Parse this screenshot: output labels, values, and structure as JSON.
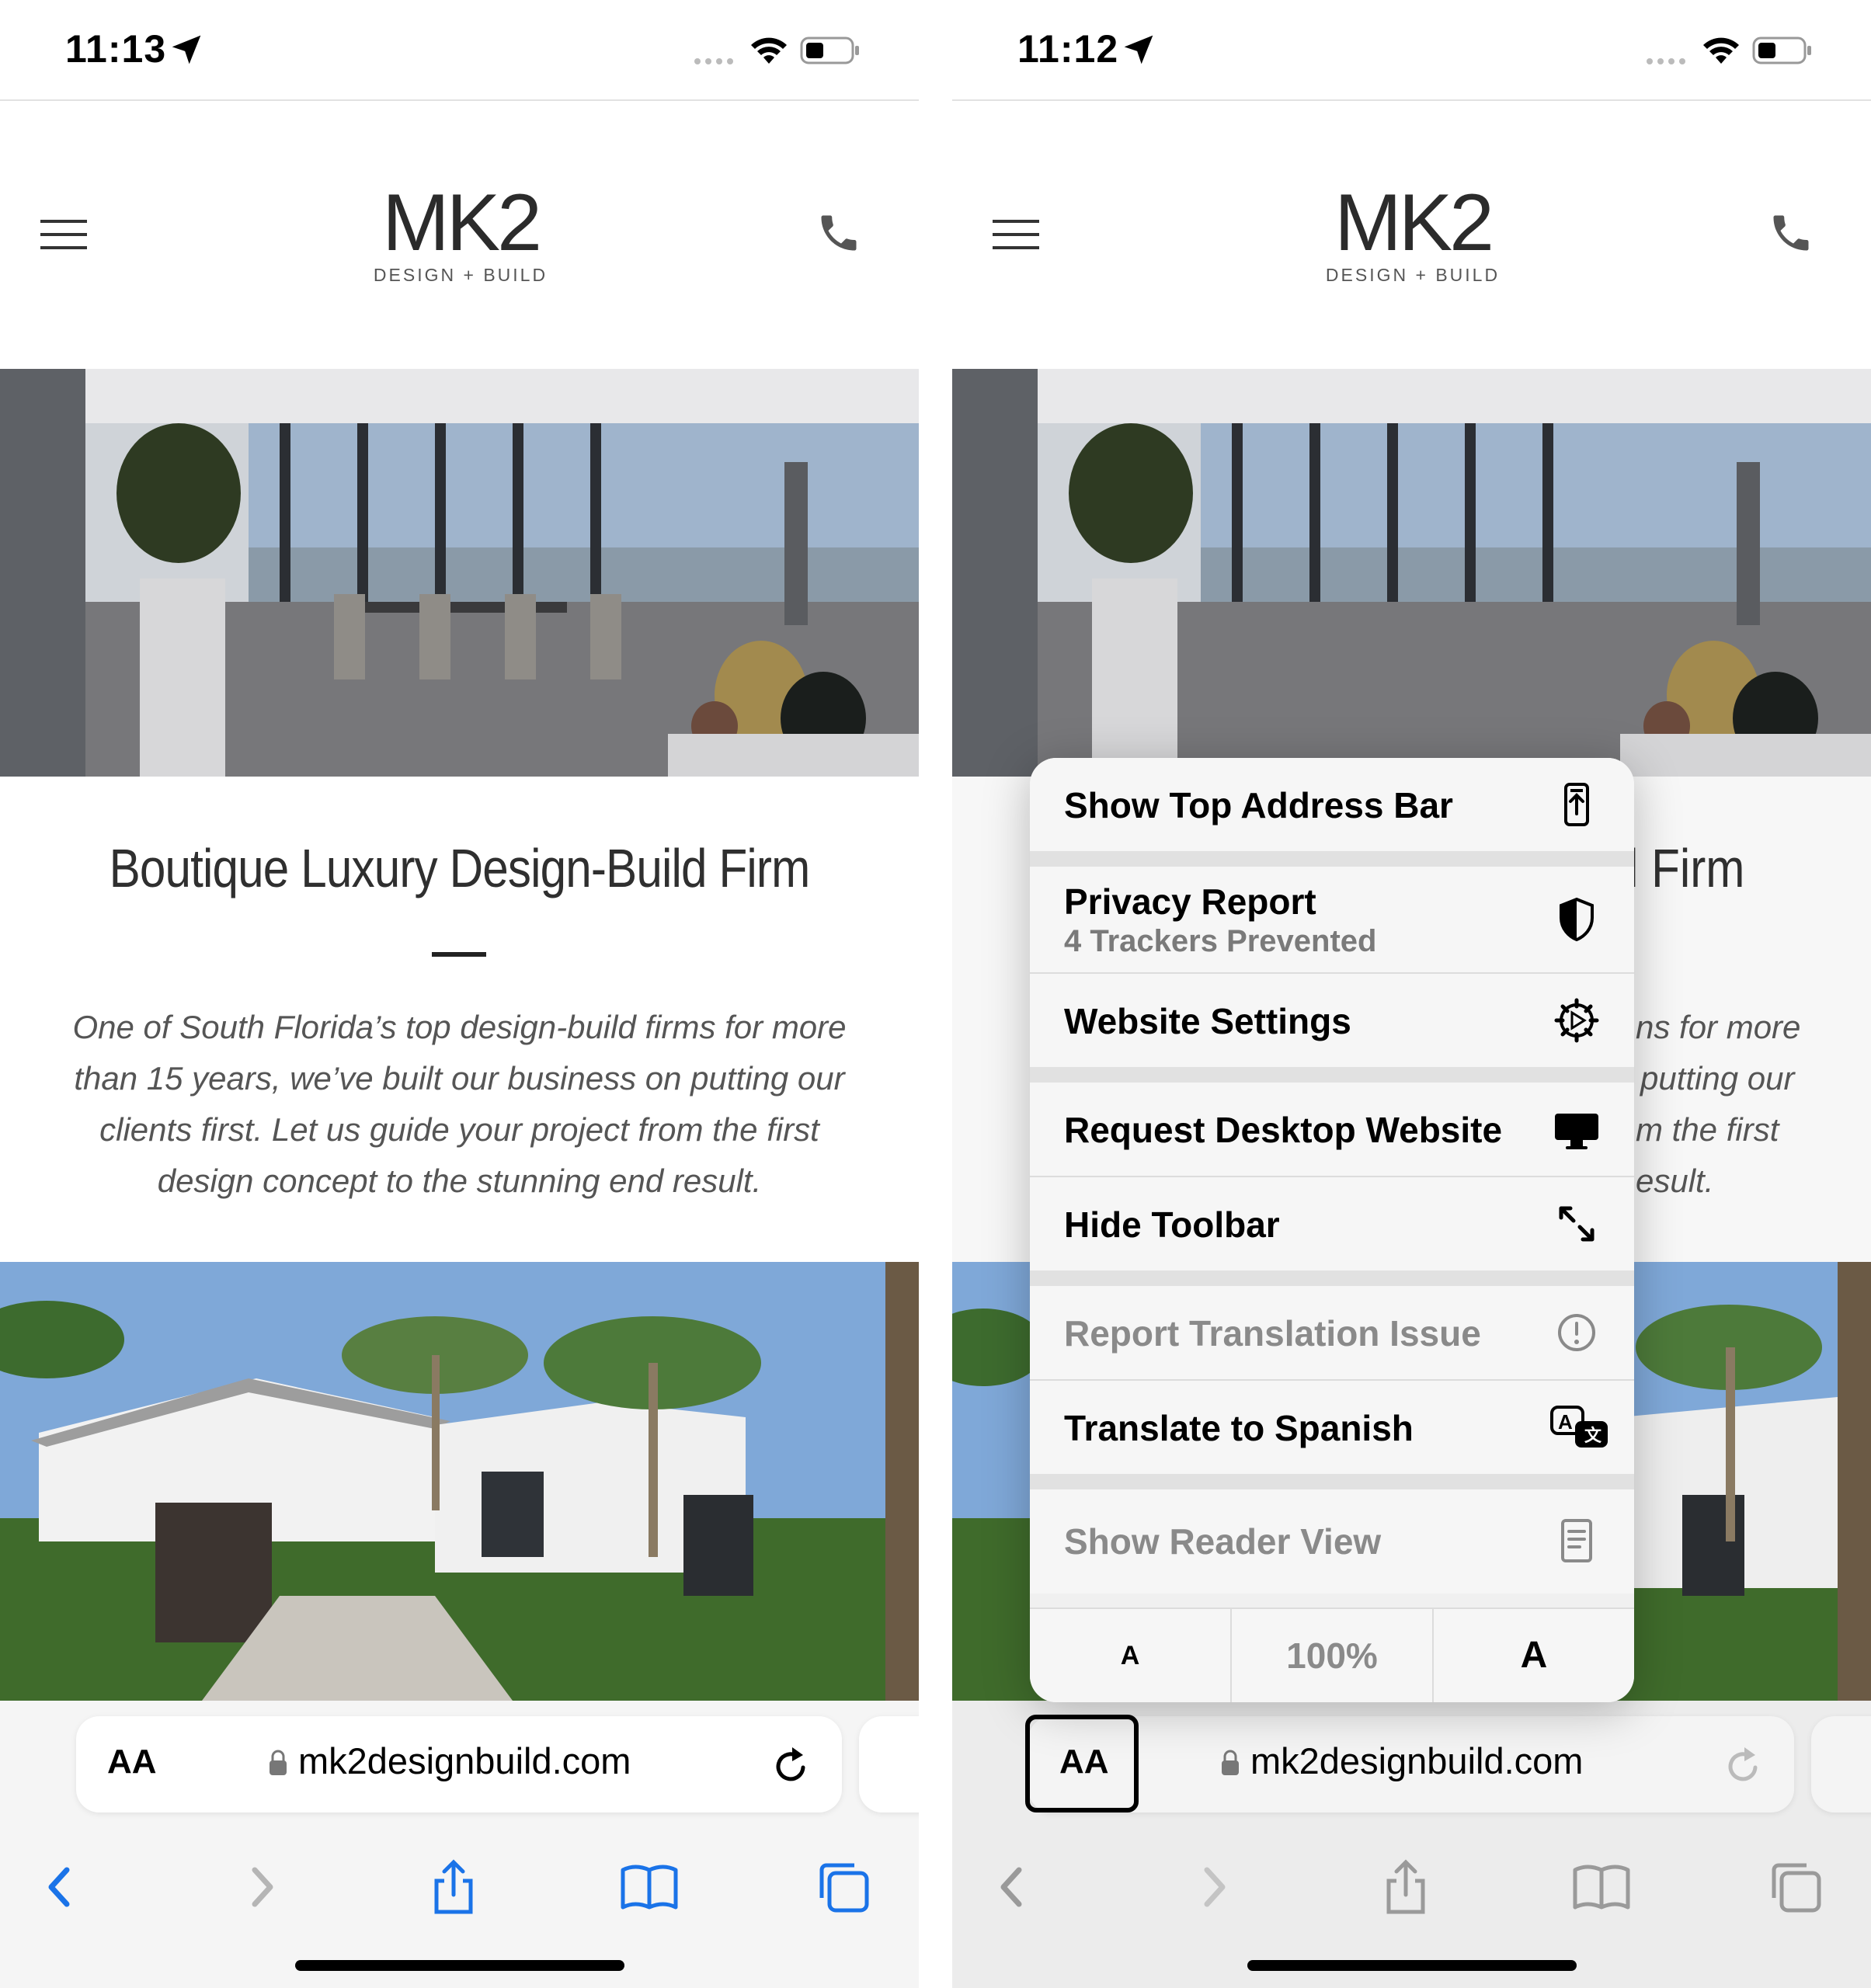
{
  "left_screen": {
    "status": {
      "time": "11:13"
    },
    "site": {
      "logo_main": "MK2",
      "logo_sub": "DESIGN + BUILD",
      "headline": "Boutique Luxury Design-Build Firm",
      "intro": "One of South Florida’s top design-build firms for more than 15 years, we’ve built our business on putting our clients first. Let us guide your project from the first design concept to the stunning end result."
    },
    "address_bar": {
      "aa_label": "AA",
      "url": "mk2designbuild.com"
    }
  },
  "right_screen": {
    "status": {
      "time": "11:12"
    },
    "site": {
      "logo_main": "MK2",
      "logo_sub": "DESIGN + BUILD",
      "headline_fragment": "l Firm",
      "intro_fragments": [
        "ns for more",
        "putting our",
        "m the first",
        "esult."
      ]
    },
    "menu": {
      "items": [
        {
          "label": "Show Top Address Bar",
          "icon": "top-address-bar-icon"
        },
        {
          "label": "Privacy Report",
          "sublabel": "4 Trackers Prevented",
          "icon": "privacy-shield-icon"
        },
        {
          "label": "Website Settings",
          "icon": "gear-icon"
        },
        {
          "label": "Request Desktop Website",
          "icon": "desktop-icon"
        },
        {
          "label": "Hide Toolbar",
          "icon": "expand-arrows-icon"
        },
        {
          "label": "Report Translation Issue",
          "icon": "exclamation-circle-icon"
        },
        {
          "label": "Translate to Spanish",
          "icon": "translate-icon"
        },
        {
          "label": "Show Reader View",
          "icon": "reader-view-icon"
        }
      ],
      "zoom": {
        "decrease": "A",
        "level": "100%",
        "increase": "A"
      }
    },
    "address_bar": {
      "aa_label": "AA",
      "url": "mk2designbuild.com"
    }
  },
  "colors": {
    "ios_blue": "#1a73e8",
    "disabled_gray": "#8a8a8a"
  }
}
